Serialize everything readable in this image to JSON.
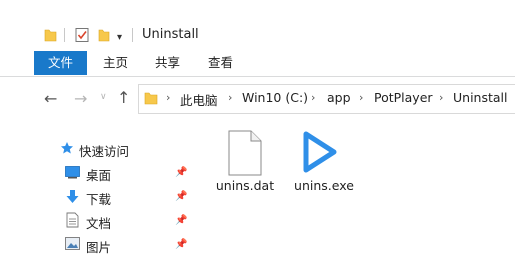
{
  "window": {
    "title": "Uninstall"
  },
  "ribbon": {
    "file_tab": "文件",
    "tabs": [
      "主页",
      "共享",
      "查看"
    ]
  },
  "address": {
    "crumbs": [
      "此电脑",
      "Win10 (C:)",
      "app",
      "PotPlayer",
      "Uninstall"
    ]
  },
  "nav_pane": {
    "quick_access": "快速访问",
    "items": [
      {
        "label": "桌面",
        "icon": "desktop-icon"
      },
      {
        "label": "下载",
        "icon": "download-icon"
      },
      {
        "label": "文档",
        "icon": "document-icon"
      },
      {
        "label": "图片",
        "icon": "pictures-icon"
      }
    ]
  },
  "files": [
    {
      "name": "unins.dat",
      "icon": "generic-file-icon"
    },
    {
      "name": "unins.exe",
      "icon": "potplayer-play-icon"
    }
  ],
  "colors": {
    "accent": "#1979ca",
    "folder": "#f7c84b",
    "play": "#2f8fe8"
  }
}
